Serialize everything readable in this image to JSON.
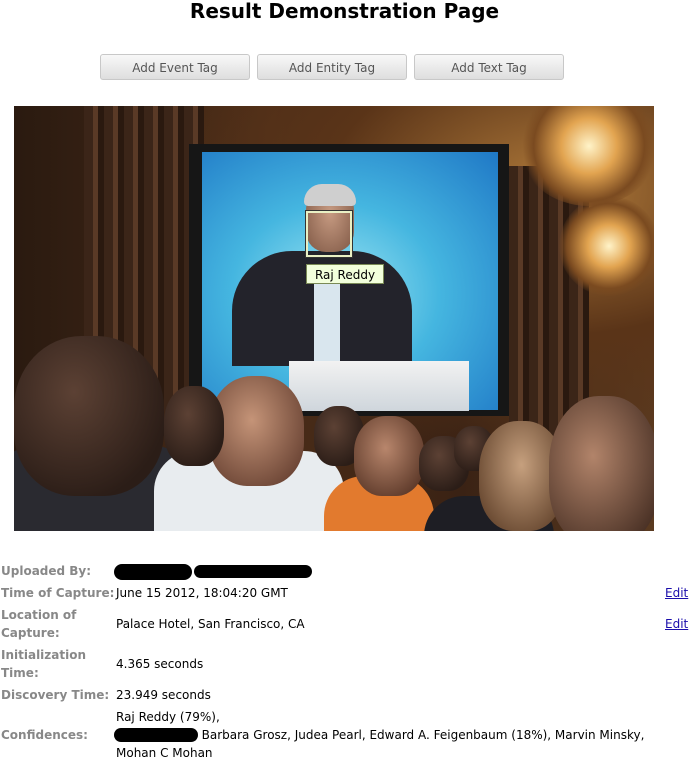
{
  "page": {
    "title": "Result Demonstration Page"
  },
  "toolbar": {
    "add_event_tag": "Add Event Tag",
    "add_entity_tag": "Add Entity Tag",
    "add_text_tag": "Add Text Tag"
  },
  "photo": {
    "face_tag_label": "Raj Reddy"
  },
  "details": {
    "uploaded_by_label": "Uploaded By:",
    "uploaded_by_value": "(redacted)",
    "time_of_capture_label": "Time of Capture:",
    "time_of_capture_value": "June 15 2012, 18:04:20 GMT",
    "location_label_line1": "Location of",
    "location_label_line2": "Capture:",
    "location_value": "Palace Hotel, San Francisco, CA",
    "init_time_label_line1": "Initialization",
    "init_time_label_line2": "Time:",
    "init_time_value": "4.365 seconds",
    "discovery_time_label": "Discovery Time:",
    "discovery_time_value": "23.949 seconds",
    "confidences_label": "Confidences:",
    "confidences_line1": "Raj Reddy (79%),",
    "confidences_line2": ", Barbara Grosz, Judea Pearl, Edward A. Feigenbaum (18%), Marvin Minsky,",
    "confidences_line3": "Mohan C Mohan",
    "edit_label": "Edit"
  }
}
